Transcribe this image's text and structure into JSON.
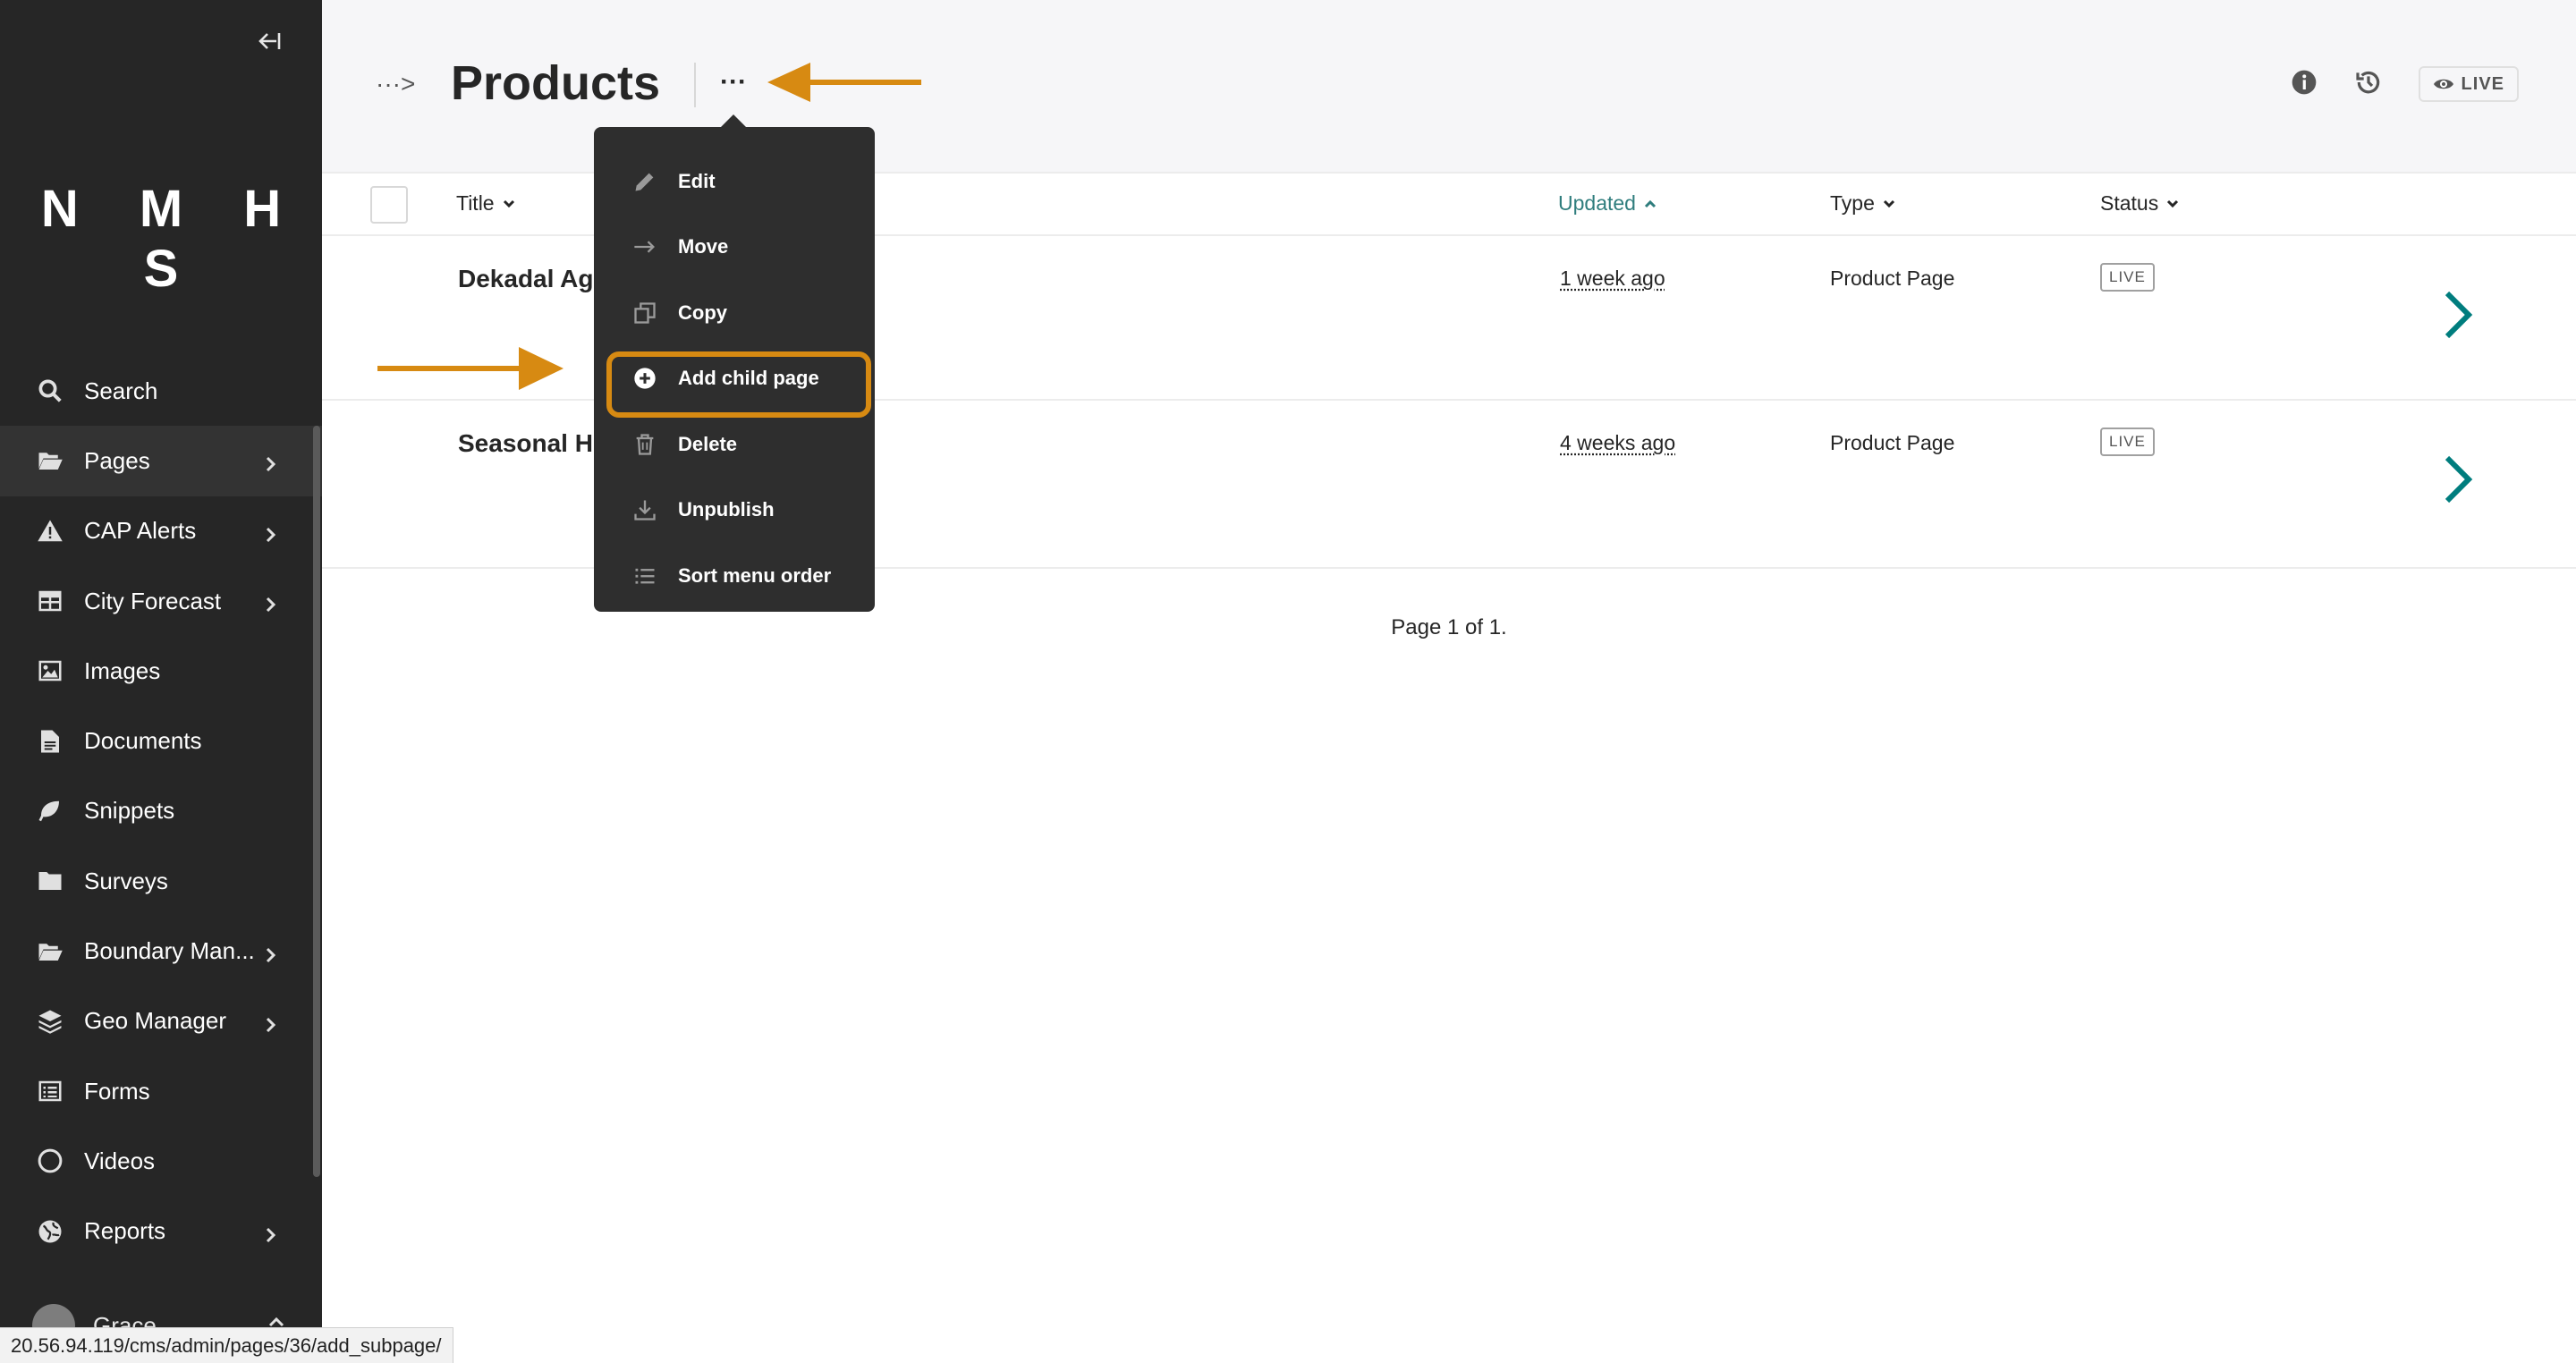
{
  "sidebar": {
    "logo": "N M H S",
    "items": [
      {
        "label": "Search",
        "icon": "search-icon",
        "chevron": false
      },
      {
        "label": "Pages",
        "icon": "folder-open-icon",
        "chevron": true,
        "active": true
      },
      {
        "label": "CAP Alerts",
        "icon": "warning-icon",
        "chevron": true
      },
      {
        "label": "City Forecast",
        "icon": "table-icon",
        "chevron": true
      },
      {
        "label": "Images",
        "icon": "image-icon",
        "chevron": false
      },
      {
        "label": "Documents",
        "icon": "document-icon",
        "chevron": false
      },
      {
        "label": "Snippets",
        "icon": "snippet-icon",
        "chevron": false
      },
      {
        "label": "Surveys",
        "icon": "folder-icon",
        "chevron": false
      },
      {
        "label": "Boundary Man...",
        "icon": "folder-open-icon",
        "chevron": true
      },
      {
        "label": "Geo Manager",
        "icon": "layers-icon",
        "chevron": true
      },
      {
        "label": "Forms",
        "icon": "list-icon",
        "chevron": false
      },
      {
        "label": "Videos",
        "icon": "circle-icon",
        "chevron": false
      },
      {
        "label": "Reports",
        "icon": "globe-icon",
        "chevron": true
      }
    ],
    "account_name": "Grace"
  },
  "header": {
    "breadcrumb_toggle": "···>",
    "title": "Products",
    "more": "···",
    "live_label": "LIVE"
  },
  "table": {
    "columns": {
      "title": "Title",
      "updated": "Updated",
      "type": "Type",
      "status": "Status"
    },
    "rows": [
      {
        "title": "Dekadal Ag",
        "updated": "1 week ago",
        "type": "Product Page",
        "status": "LIVE"
      },
      {
        "title": "Seasonal H",
        "updated": "4 weeks ago",
        "type": "Product Page",
        "status": "LIVE"
      }
    ],
    "pagination": "Page 1 of 1."
  },
  "dropdown": {
    "items": [
      {
        "label": "Edit",
        "icon": "pencil-icon"
      },
      {
        "label": "Move",
        "icon": "arrow-right-icon"
      },
      {
        "label": "Copy",
        "icon": "copy-icon"
      },
      {
        "label": "Add child page",
        "icon": "plus-circle-icon",
        "highlighted": true
      },
      {
        "label": "Delete",
        "icon": "trash-icon"
      },
      {
        "label": "Unpublish",
        "icon": "download-icon"
      },
      {
        "label": "Sort menu order",
        "icon": "list-icon"
      }
    ]
  },
  "status_url": "20.56.94.119/cms/admin/pages/36/add_subpage/",
  "colors": {
    "sidebar": "#262626",
    "accent": "#007d7e",
    "annotation": "#d78a12",
    "dropdown": "#2e2e2e"
  }
}
